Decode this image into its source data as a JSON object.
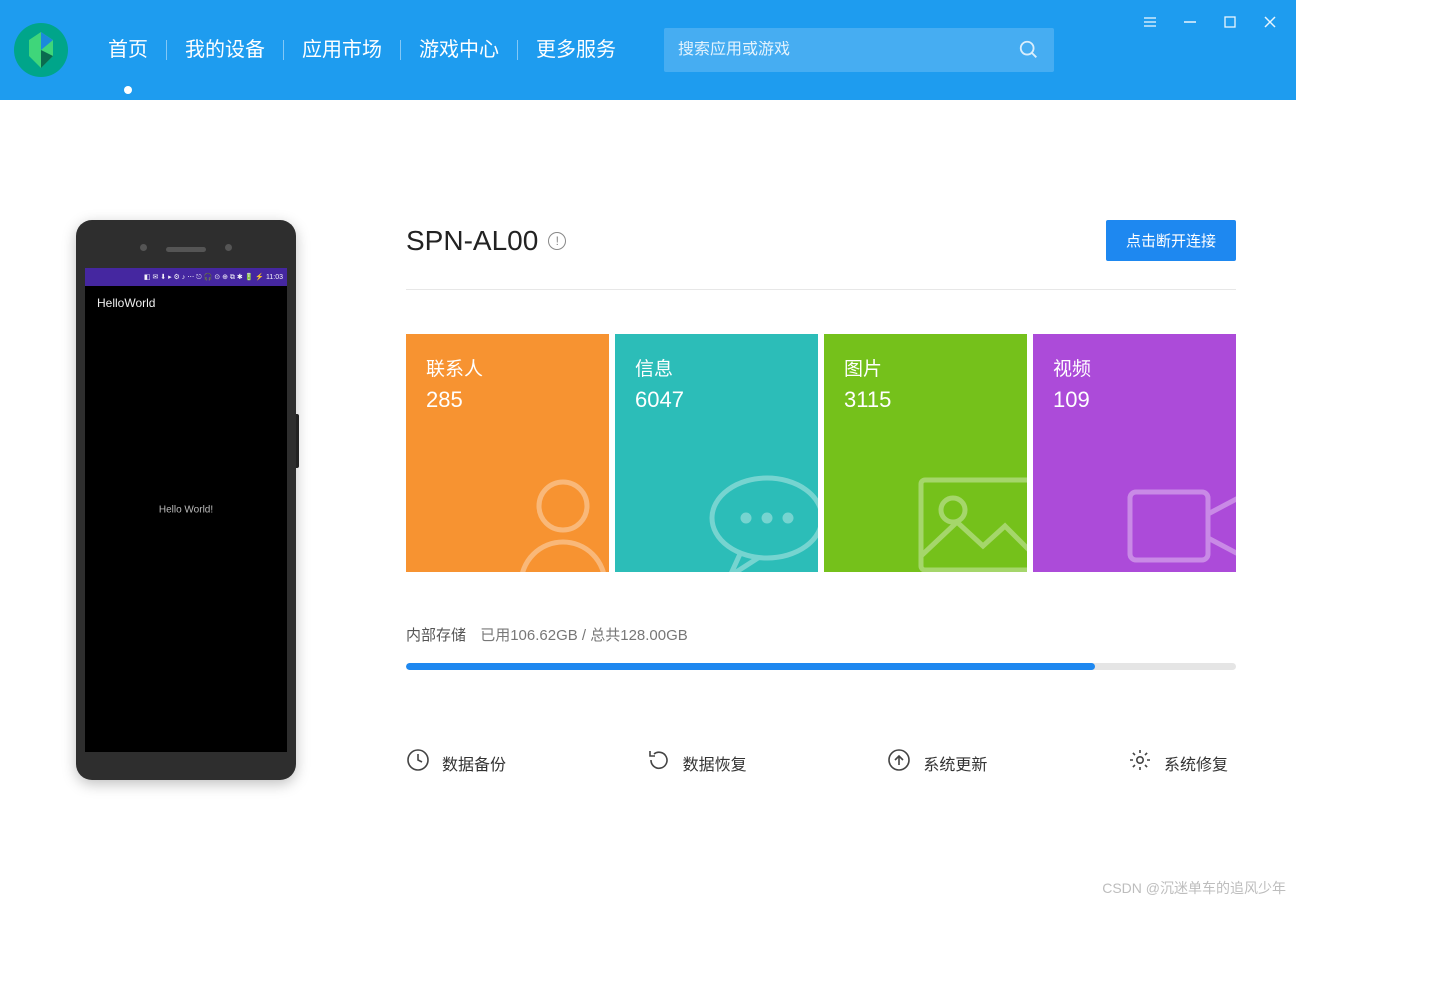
{
  "header": {
    "nav": [
      "首页",
      "我的设备",
      "应用市场",
      "游戏中心",
      "更多服务"
    ],
    "active_index": 0,
    "search_placeholder": "搜索应用或游戏"
  },
  "phone": {
    "status_time": "11:03",
    "app_header": "HelloWorld",
    "screen_text": "Hello World!"
  },
  "device": {
    "name": "SPN-AL00",
    "disconnect_btn": "点击断开连接"
  },
  "tiles": [
    {
      "label": "联系人",
      "value": "285",
      "color": "t-orange",
      "icon": "contact"
    },
    {
      "label": "信息",
      "value": "6047",
      "color": "t-teal",
      "icon": "message"
    },
    {
      "label": "图片",
      "value": "3115",
      "color": "t-green",
      "icon": "image"
    },
    {
      "label": "视频",
      "value": "109",
      "color": "t-purple",
      "icon": "video"
    }
  ],
  "storage": {
    "title": "内部存储",
    "used_text": "已用106.62GB / 总共128.00GB",
    "used_gb": 106.62,
    "total_gb": 128.0,
    "percent": 83
  },
  "actions": [
    {
      "label": "数据备份",
      "icon": "backup"
    },
    {
      "label": "数据恢复",
      "icon": "restore"
    },
    {
      "label": "系统更新",
      "icon": "update"
    },
    {
      "label": "系统修复",
      "icon": "repair"
    }
  ],
  "watermark": "CSDN @沉迷单车的追风少年"
}
